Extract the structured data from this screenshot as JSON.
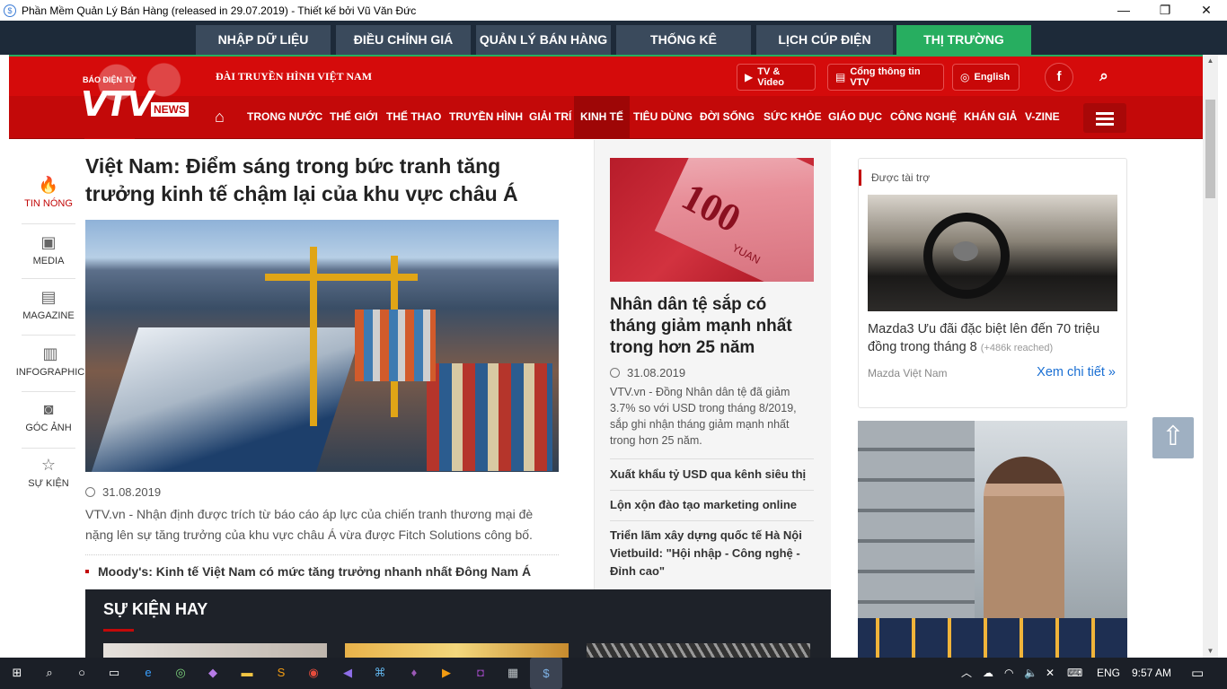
{
  "window": {
    "title": "Phần Mềm Quản Lý Bán Hàng (released in 29.07.2019) - Thiết kế bởi Vũ Văn Đức",
    "minimize": "—",
    "maximize": "❐",
    "close": "✕"
  },
  "app_tabs": [
    {
      "label": "NHẬP DỮ LIỆU"
    },
    {
      "label": "ĐIỀU CHỈNH GIÁ"
    },
    {
      "label": "QUẢN LÝ BÁN HÀNG"
    },
    {
      "label": "THỐNG KÊ"
    },
    {
      "label": "LỊCH CÚP ĐIỆN"
    },
    {
      "label": "THỊ TRƯỜNG",
      "active": true
    }
  ],
  "vtv": {
    "logo_small": "BÁO ĐIỆN TỬ",
    "logo_main": "VTV",
    "logo_news": "NEWS",
    "channel": "ĐÀI TRUYỀN HÌNH VIỆT NAM",
    "tv_video": "TV & Video",
    "portal": "Cổng thông tin VTV",
    "english": "English",
    "facebook": "f",
    "search_icon": "search-icon",
    "nav": [
      "TRONG NƯỚC",
      "THẾ GIỚI",
      "THỂ THAO",
      "TRUYỀN HÌNH",
      "GIẢI TRÍ",
      "KINH TẾ",
      "TIÊU DÙNG",
      "ĐỜI SỐNG",
      "SỨC KHỎE",
      "GIÁO DỤC",
      "CÔNG NGHỆ",
      "KHÁN GIẢ",
      "V-ZINE"
    ],
    "nav_active": "KINH TẾ"
  },
  "rail": [
    {
      "label": "TIN NÓNG",
      "icon": "fire-icon"
    },
    {
      "label": "MEDIA",
      "icon": "media-icon"
    },
    {
      "label": "MAGAZINE",
      "icon": "magazine-icon"
    },
    {
      "label": "INFOGRAPHIC",
      "icon": "chart-icon"
    },
    {
      "label": "GÓC ẢNH",
      "icon": "camera-icon"
    },
    {
      "label": "SỰ KIỆN",
      "icon": "star-icon"
    }
  ],
  "main": {
    "title": "Việt Nam: Điểm sáng trong bức tranh tăng trưởng kinh tế chậm lại của khu vực châu Á",
    "date": "31.08.2019",
    "summary": "VTV.vn - Nhận định được trích từ báo cáo áp lực của chiến tranh thương mại đè nặng lên sự tăng trưởng của khu vực châu Á vừa được Fitch Solutions công bố.",
    "related": "Moody's: Kinh tế Việt Nam có mức tăng trưởng nhanh nhất Đông Nam Á"
  },
  "events": {
    "heading": "SỰ KIỆN HAY"
  },
  "middle": {
    "img_num": "100",
    "img_yuan": "YUAN",
    "title": "Nhân dân tệ sắp có tháng giảm mạnh nhất trong hơn 25 năm",
    "date": "31.08.2019",
    "summary": "VTV.vn - Đồng Nhân dân tệ đã giảm 3.7% so với USD trong tháng 8/2019, sắp ghi nhận tháng giảm mạnh nhất trong hơn 25 năm.",
    "links": [
      "Xuất khẩu tỷ USD qua kênh siêu thị",
      "Lộn xộn đào tạo marketing online",
      "Triển lãm xây dựng quốc tế Hà Nội Vietbuild: \"Hội nhập - Công nghệ - Đỉnh cao\""
    ]
  },
  "sponsor": {
    "label": "Được tài trợ",
    "title": "Mazda3 Ưu đãi đặc biệt lên đến 70 triệu đồng trong tháng 8",
    "reached": "(+486k reached)",
    "source": "Mazda Việt Nam",
    "more": "Xem chi tiết »"
  },
  "taskbar": {
    "lang": "ENG",
    "time": "9:57 AM",
    "icons": [
      "start-icon",
      "search-icon",
      "cortana-icon",
      "taskview-icon",
      "edge-icon",
      "app-icon",
      "vs-icon",
      "folder-icon",
      "sublime-icon",
      "chrome-icon",
      "vs-code-icon",
      "app2-icon",
      "vs2-icon",
      "media-player-icon",
      "app3-icon",
      "app4-icon",
      "sales-app-icon"
    ]
  },
  "colors": {
    "vtv_red": "#d50b0b",
    "tab_active": "#27ae60",
    "tab_bg": "#3a4a5c",
    "link_blue": "#1a6fd3"
  }
}
